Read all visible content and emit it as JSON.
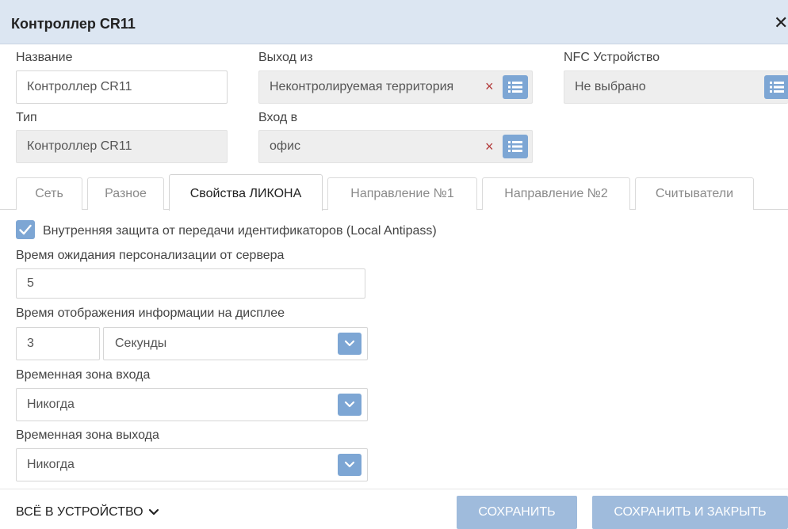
{
  "window": {
    "title": "Контроллер CR11",
    "close_symbol": "✕"
  },
  "fields": {
    "name": {
      "label": "Название",
      "value": "Контроллер CR11"
    },
    "exit_from": {
      "label": "Выход из",
      "value": "Неконтролируемая территория",
      "clear_symbol": "×"
    },
    "nfc": {
      "label": "NFC Устройство",
      "value": "Не выбрано"
    },
    "type": {
      "label": "Тип",
      "value": "Контроллер CR11"
    },
    "entry_to": {
      "label": "Вход в",
      "value": "офис",
      "clear_symbol": "×"
    }
  },
  "tabs": [
    {
      "label": "Сеть"
    },
    {
      "label": "Разное"
    },
    {
      "label": "Свойства ЛИКОНА",
      "active": true
    },
    {
      "label": "Направление №1"
    },
    {
      "label": "Направление №2"
    },
    {
      "label": "Считыватели"
    }
  ],
  "liquona": {
    "local_antipass": {
      "label": "Внутренняя защита от передачи идентификаторов (Local Antipass)",
      "checked": true
    },
    "personalization_wait": {
      "label": "Время ожидания персонализации от сервера",
      "value": "5"
    },
    "display_time": {
      "label": "Время отображения информации на дисплее",
      "value": "3",
      "unit": "Секунды"
    },
    "entry_time_zone": {
      "label": "Временная зона входа",
      "value": "Никогда"
    },
    "exit_time_zone": {
      "label": "Временная зона выхода",
      "value": "Никогда"
    }
  },
  "footer": {
    "all_to_device": "ВСЁ В УСТРОЙСТВО",
    "save": "СОХРАНИТЬ",
    "save_close": "СОХРАНИТЬ И ЗАКРЫТЬ"
  },
  "colors": {
    "header_bg": "#dce6f2",
    "accent": "#7da6d4",
    "button_bg": "#9fbbdc",
    "clear_red": "#b23a3a"
  },
  "icons": {
    "close": "close-icon",
    "list": "list-icon",
    "clear": "clear-icon",
    "check": "check-icon",
    "dropdown": "chevron-down-icon"
  }
}
